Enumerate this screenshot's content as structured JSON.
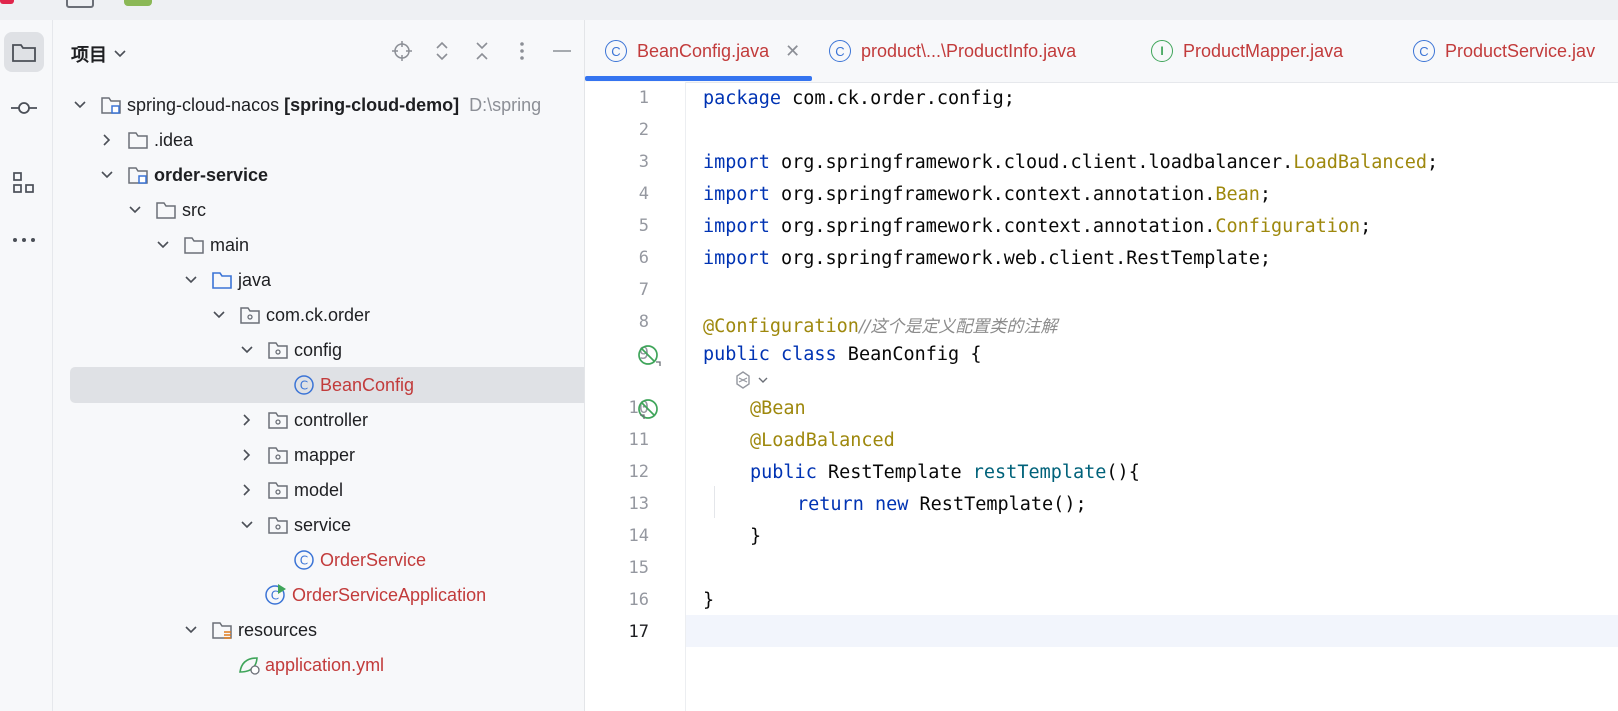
{
  "project_panel": {
    "title": "项目",
    "tree": [
      {
        "label": "spring-cloud-nacos",
        "extra": "[spring-cloud-demo]",
        "path": "D:\\spring"
      },
      {
        "label": ".idea"
      },
      {
        "label": "order-service"
      },
      {
        "label": "src"
      },
      {
        "label": "main"
      },
      {
        "label": "java"
      },
      {
        "label": "com.ck.order"
      },
      {
        "label": "config"
      },
      {
        "label": "BeanConfig"
      },
      {
        "label": "controller"
      },
      {
        "label": "mapper"
      },
      {
        "label": "model"
      },
      {
        "label": "service"
      },
      {
        "label": "OrderService"
      },
      {
        "label": "OrderServiceApplication"
      },
      {
        "label": "resources"
      },
      {
        "label": "application.yml"
      }
    ]
  },
  "tabs": [
    {
      "label": "BeanConfig.java",
      "icon": "class-icon",
      "active": true
    },
    {
      "label": "product\\...\\ProductInfo.java",
      "icon": "class-icon"
    },
    {
      "label": "ProductMapper.java",
      "icon": "interface-icon"
    },
    {
      "label": "ProductService.jav",
      "icon": "class-icon"
    }
  ],
  "editor": {
    "line_numbers": [
      "1",
      "2",
      "3",
      "4",
      "5",
      "6",
      "7",
      "8",
      "9",
      "10",
      "11",
      "12",
      "13",
      "14",
      "15",
      "16",
      "17"
    ],
    "current_line": "17",
    "code": {
      "l1_kw": "package",
      "l1_rest": " com.ck.order.config;",
      "l3_kw": "import",
      "l3_path": " org.springframework.cloud.client.loadbalancer.",
      "l3_cls": "LoadBalanced",
      "l3_end": ";",
      "l4_kw": "import",
      "l4_path": " org.springframework.context.annotation.",
      "l4_cls": "Bean",
      "l4_end": ";",
      "l5_kw": "import",
      "l5_path": " org.springframework.context.annotation.",
      "l5_cls": "Configuration",
      "l5_end": ";",
      "l6_kw": "import",
      "l6_rest": " org.springframework.web.client.RestTemplate;",
      "l8_ann": "@Configuration",
      "l8_cmt": "//这个是定义配置类的注解",
      "l9_kw1": "public",
      "l9_kw2": "class",
      "l9_rest": " BeanConfig {",
      "l10_ann": "@Bean",
      "l11_ann": "@LoadBalanced",
      "l12_kw": "public",
      "l12_type": " RestTemplate ",
      "l12_fn": "restTemplate",
      "l12_end": "(){",
      "l13_kw1": "return",
      "l13_kw2": "new",
      "l13_rest": " RestTemplate();",
      "l14": "}",
      "l16": "}"
    }
  },
  "colors": {
    "accent": "#3574f0",
    "keyword": "#0033b3",
    "annotation": "#9e880d",
    "modified_file": "#c23b3b"
  }
}
